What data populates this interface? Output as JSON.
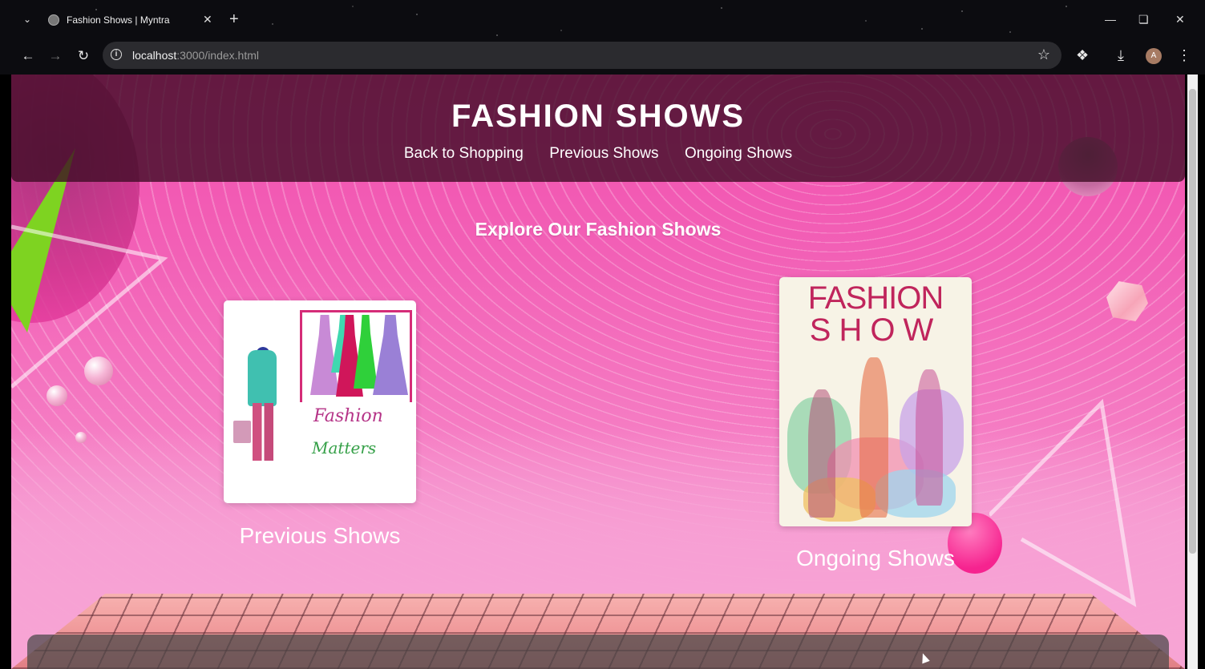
{
  "browser": {
    "tab_title": "Fashion Shows | Myntra",
    "url_host": "localhost",
    "url_path": ":3000/index.html",
    "profile_initial": "A"
  },
  "header": {
    "title": "FASHION SHOWS",
    "nav": [
      "Back to Shopping",
      "Previous Shows",
      "Ongoing Shows"
    ]
  },
  "main": {
    "heading": "Explore Our Fashion Shows",
    "cards": [
      {
        "label": "Previous Shows",
        "art_text_1": "Fashion",
        "art_text_2": "Matters"
      },
      {
        "label": "Ongoing Shows",
        "art_title_1": "FASHION",
        "art_title_2": "SHOW"
      }
    ]
  },
  "icons": [
    "chevron-down-icon",
    "globe-icon",
    "close-icon",
    "plus-icon",
    "back-icon",
    "forward-icon",
    "reload-icon",
    "info-icon",
    "star-icon",
    "extensions-icon",
    "download-icon",
    "menu-icon",
    "minimize-icon",
    "restore-icon"
  ],
  "colors": {
    "accent": "#f24fae",
    "header_bg": "#3c0a23",
    "title_text": "#ffffff"
  }
}
